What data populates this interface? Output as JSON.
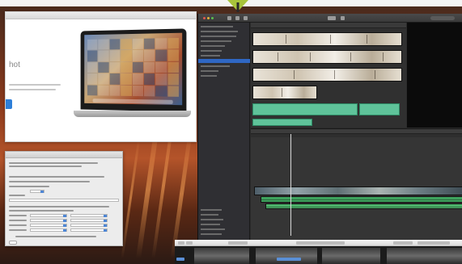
{
  "preview_window": {
    "heading": "hot",
    "line1": "",
    "line2": ""
  },
  "dialog": {
    "title": ""
  },
  "editor": {
    "library_items": [],
    "timeline_items": []
  },
  "colors": {
    "accent_blue": "#2f67c4",
    "clip_green": "#5fc39a",
    "audio_green": "#3fa35e",
    "editor_bg": "#2b2b2b"
  },
  "icons": {
    "pin": "pin-marker-icon",
    "search": "search-icon"
  }
}
